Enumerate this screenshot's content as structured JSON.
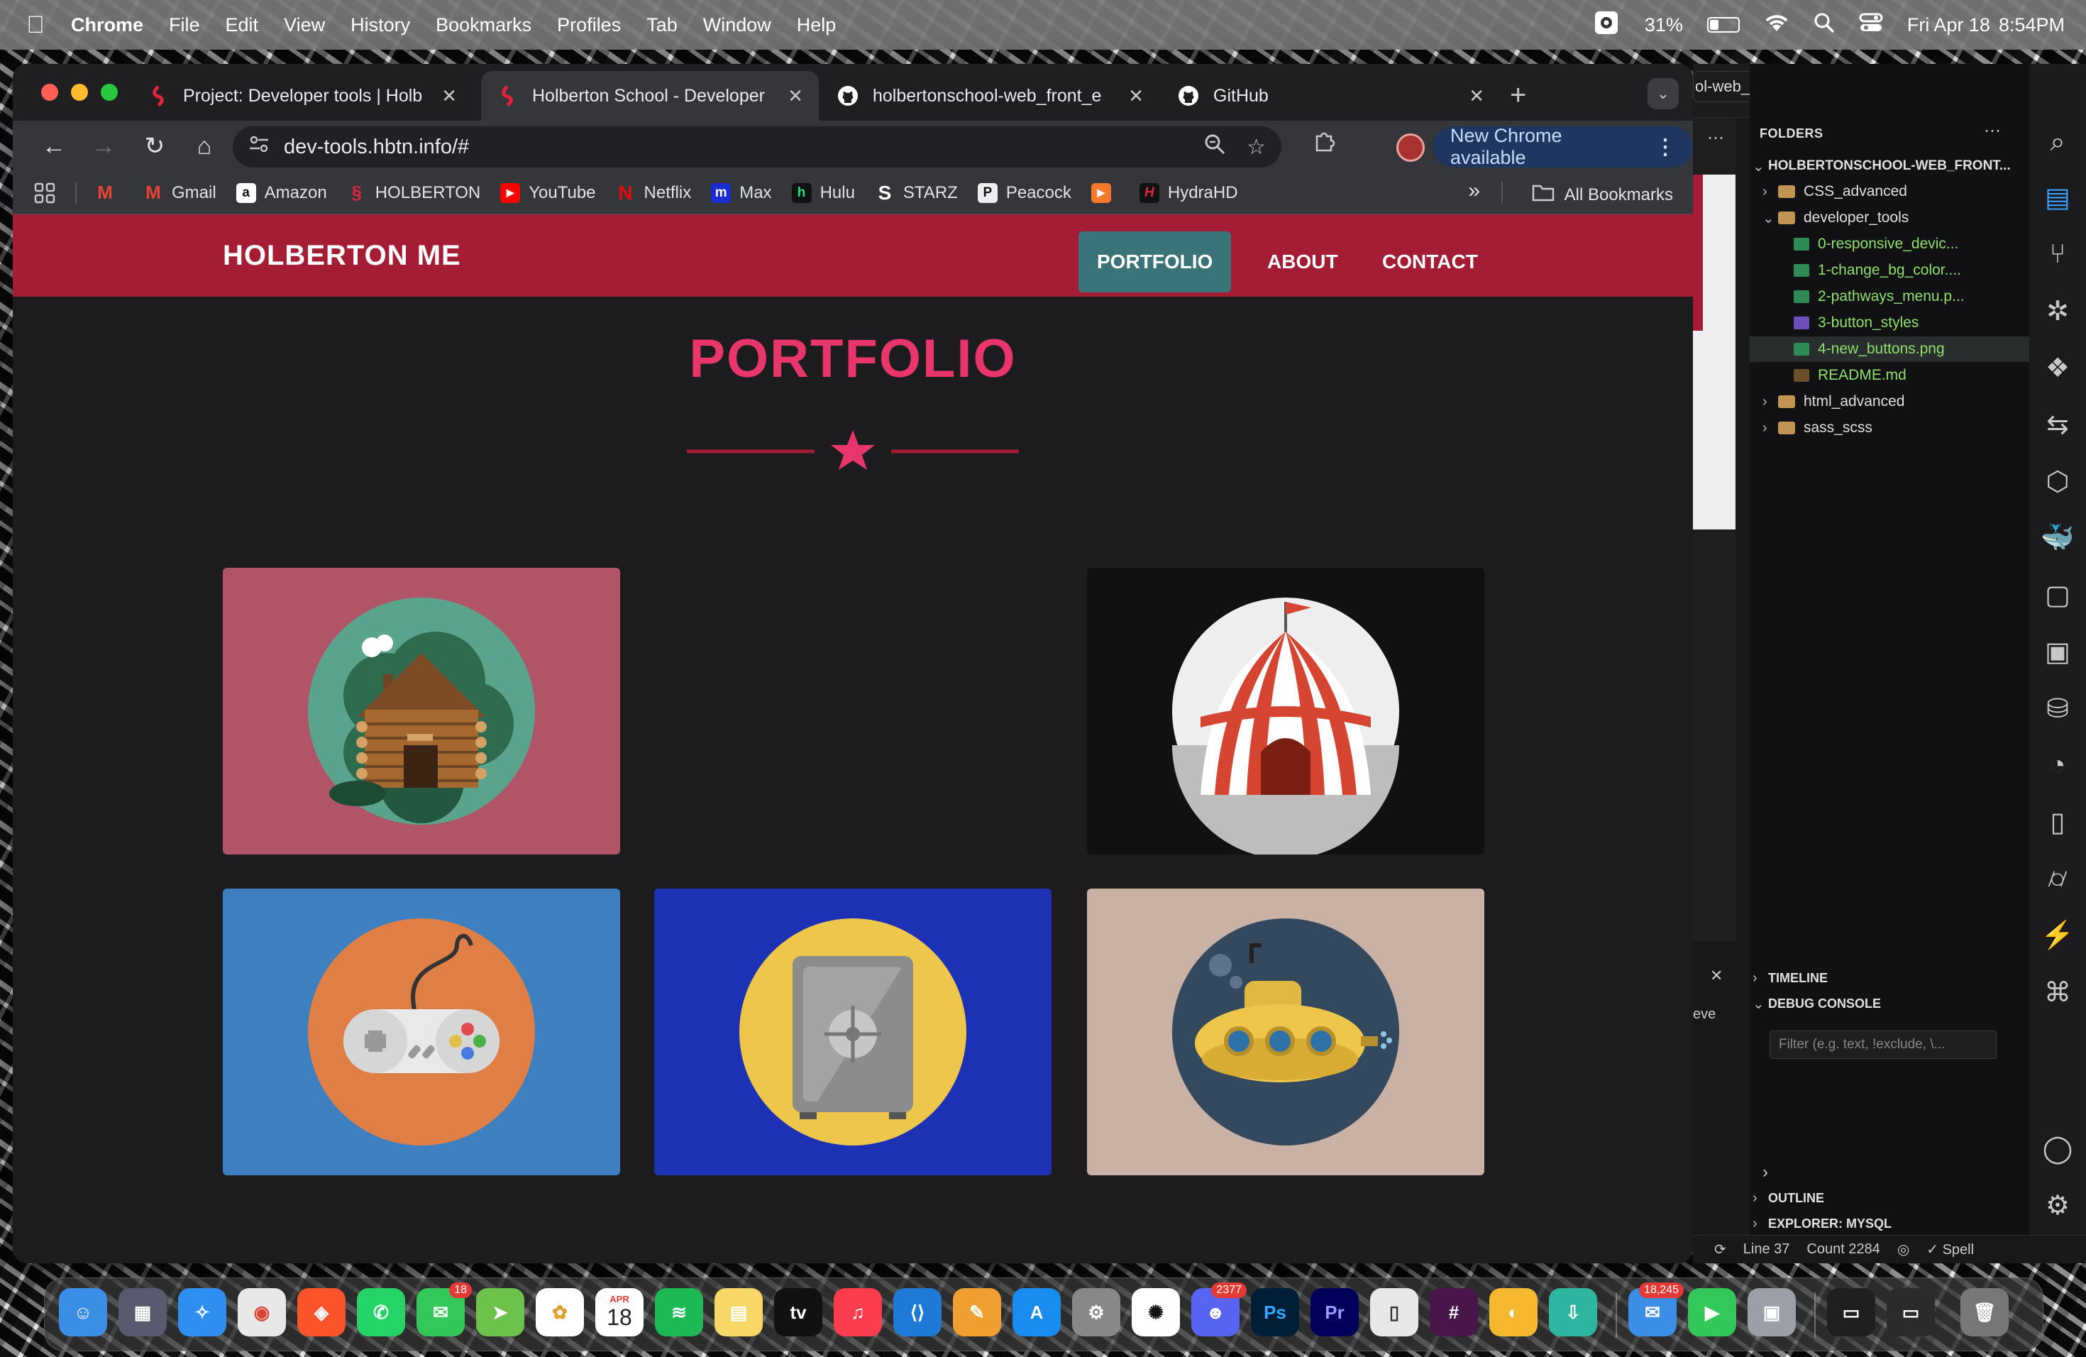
{
  "menubar": {
    "app": "Chrome",
    "items": [
      "File",
      "Edit",
      "View",
      "History",
      "Bookmarks",
      "Profiles",
      "Tab",
      "Window",
      "Help"
    ],
    "battery": "31%",
    "date": "Fri Apr 18",
    "time": "8:54PM"
  },
  "browser": {
    "tabs": [
      {
        "title": "Project: Developer tools | Holb",
        "active": false
      },
      {
        "title": "Holberton School - Developer",
        "active": true
      },
      {
        "title": "holbertonschool-web_front_e",
        "active": false
      },
      {
        "title": "GitHub",
        "active": false
      }
    ],
    "url": "dev-tools.hbtn.info/#",
    "new_chrome_label": "New Chrome available",
    "bookmarks": [
      {
        "label": "",
        "icon": "gmail-icon"
      },
      {
        "label": "Gmail",
        "icon": "gmail-icon"
      },
      {
        "label": "Amazon",
        "icon": "amazon-icon"
      },
      {
        "label": "HOLBERTON",
        "icon": "holberton-icon"
      },
      {
        "label": "YouTube",
        "icon": "youtube-icon"
      },
      {
        "label": "Netflix",
        "icon": "netflix-icon"
      },
      {
        "label": "Max",
        "icon": "max-icon"
      },
      {
        "label": "Hulu",
        "icon": "hulu-icon"
      },
      {
        "label": "STARZ",
        "icon": "starz-icon"
      },
      {
        "label": "Peacock",
        "icon": "peacock-icon"
      },
      {
        "label": "",
        "icon": "play-icon"
      },
      {
        "label": "HydraHD",
        "icon": "hydrahd-icon"
      }
    ],
    "all_bookmarks": "All Bookmarks"
  },
  "site": {
    "brand": "HOLBERTON ME",
    "nav": [
      "PORTFOLIO",
      "ABOUT",
      "CONTACT"
    ],
    "title": "PORTFOLIO",
    "cards": [
      {
        "name": "cabin",
        "bg": "#b05468"
      },
      {
        "name": "circus-tent",
        "bg": "#111111"
      },
      {
        "name": "game-controller",
        "bg": "#3d7fbf"
      },
      {
        "name": "safe",
        "bg": "#1c31b3"
      },
      {
        "name": "submarine",
        "bg": "#c9b2a5"
      }
    ],
    "colors": {
      "header": "#a51d35",
      "accent": "#e8356b",
      "teal": "#3b7478"
    }
  },
  "vscode": {
    "tab_label": "ol-web_front_end",
    "folders_label": "FOLDERS",
    "root": "HOLBERTONSCHOOL-WEB_FRONT...",
    "tree": [
      {
        "label": "CSS_advanced",
        "type": "folder",
        "depth": 1,
        "status": ""
      },
      {
        "label": "developer_tools",
        "type": "folder-open",
        "depth": 1,
        "status": ""
      },
      {
        "label": "0-responsive_devic...",
        "type": "img",
        "depth": 2,
        "status": "U"
      },
      {
        "label": "1-change_bg_color....",
        "type": "img",
        "depth": 2,
        "status": "U"
      },
      {
        "label": "2-pathways_menu.p...",
        "type": "img",
        "depth": 2,
        "status": "U"
      },
      {
        "label": "3-button_styles",
        "type": "css",
        "depth": 2,
        "status": "U"
      },
      {
        "label": "4-new_buttons.png",
        "type": "img",
        "depth": 2,
        "status": "U"
      },
      {
        "label": "README.md",
        "type": "md",
        "depth": 2,
        "status": "U"
      },
      {
        "label": "html_advanced",
        "type": "folder",
        "depth": 1,
        "status": ""
      },
      {
        "label": "sass_scss",
        "type": "folder",
        "depth": 1,
        "status": ""
      }
    ],
    "timeline": "TIMELINE",
    "debug_console": "DEBUG CONSOLE",
    "filter_placeholder": "Filter (e.g. text, !exclude, \\...",
    "outline": "OUTLINE",
    "explorer_mysql": "EXPLORER: MYSQL",
    "panel_text": "eve",
    "status": {
      "line": "Line 37",
      "count": "Count 2284",
      "spell": "Spell"
    }
  },
  "dock": {
    "calendar_month": "APR",
    "calendar_day": "18",
    "badges": {
      "messages": "18",
      "discord": "2377",
      "mail": "18,245"
    },
    "tv_label": "tv",
    "ps": "Ps",
    "pr": "Pr"
  }
}
